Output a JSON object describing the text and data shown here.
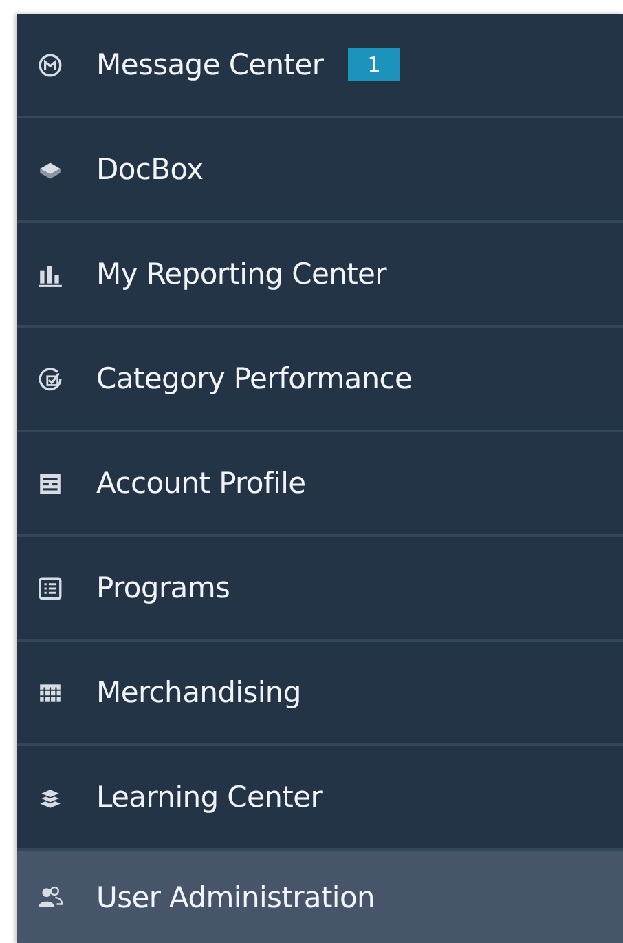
{
  "sidebar": {
    "items": [
      {
        "label": "Message Center",
        "kind": "message",
        "badge": "1",
        "selected": false
      },
      {
        "label": "DocBox",
        "kind": "box",
        "selected": false
      },
      {
        "label": "My Reporting Center",
        "kind": "chart",
        "selected": false
      },
      {
        "label": "Category Performance",
        "kind": "check",
        "selected": false
      },
      {
        "label": "Account Profile",
        "kind": "profile",
        "selected": false
      },
      {
        "label": "Programs",
        "kind": "list",
        "selected": false
      },
      {
        "label": "Merchandising",
        "kind": "shelf",
        "selected": false
      },
      {
        "label": "Learning Center",
        "kind": "books",
        "selected": false
      },
      {
        "label": "User Administration",
        "kind": "users",
        "selected": true
      }
    ]
  }
}
